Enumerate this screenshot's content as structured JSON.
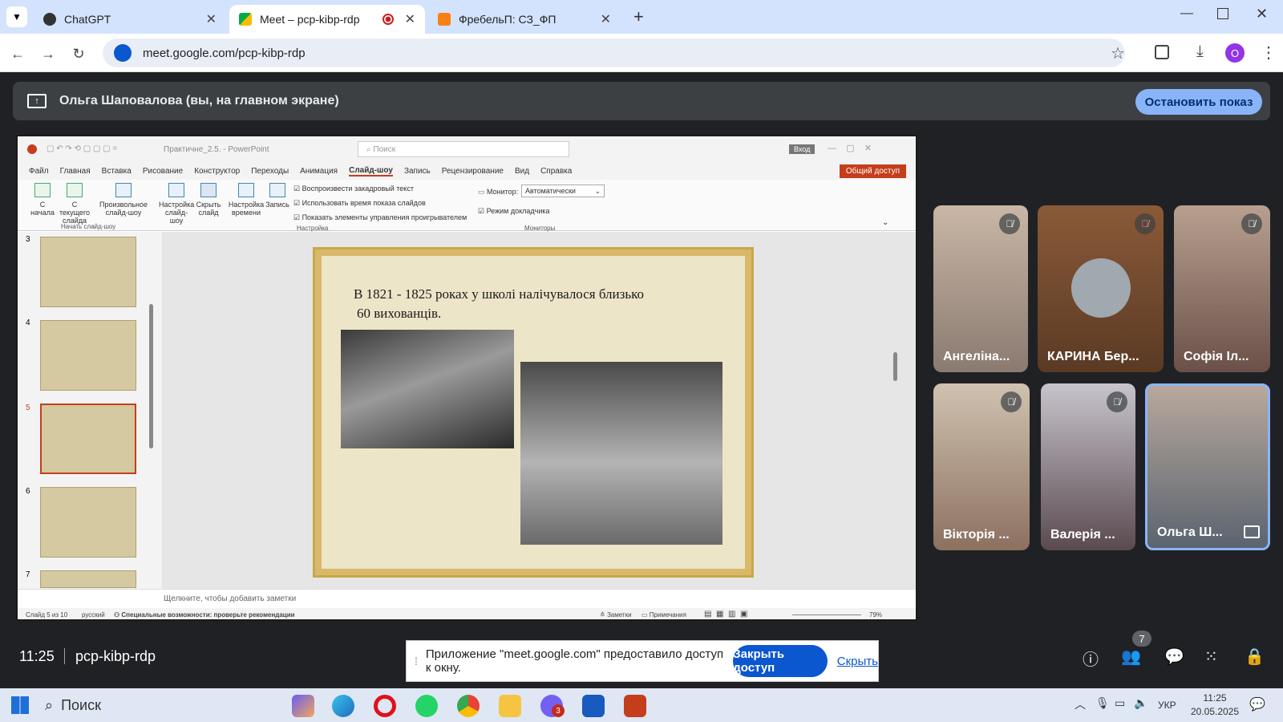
{
  "browser": {
    "tabs": [
      {
        "label": "ChatGPT"
      },
      {
        "label": "Meet – pcp-kibp-rdp"
      },
      {
        "label": "ФребельП: СЗ_ФП"
      }
    ],
    "url": "meet.google.com/pcp-kibp-rdp",
    "profile_initial": "O"
  },
  "meet": {
    "presenting_label": "Ольга Шаповалова (вы, на главном экране)",
    "stop_label": "Остановить показ",
    "time": "11:25",
    "meeting_code": "pcp-kibp-rdp",
    "participants_count": "7",
    "share_notice": "Приложение \"meet.google.com\" предоставило доступ к окну.",
    "close_access_label": "Закрыть доступ",
    "hide_label": "Скрыть",
    "participants": [
      {
        "name": "Ангеліна..."
      },
      {
        "name": "КАРИНА Бер..."
      },
      {
        "name": "Софія Іл..."
      },
      {
        "name": "Вікторія ..."
      },
      {
        "name": "Валерія ..."
      },
      {
        "name": "Ольга Ш..."
      }
    ]
  },
  "powerpoint": {
    "doc_title": "Практичне_2.5. - PowerPoint",
    "search_placeholder": "Поиск",
    "signin": "Вход",
    "share_label": "Общий доступ",
    "menu": [
      "Файл",
      "Главная",
      "Вставка",
      "Рисование",
      "Конструктор",
      "Переходы",
      "Анимация",
      "Слайд-шоу",
      "Запись",
      "Рецензирование",
      "Вид",
      "Справка"
    ],
    "ribbon": {
      "from_start": "С начала",
      "from_current": "С текущего слайда",
      "custom": "Произвольное слайд-шоу",
      "group_start": "Начать слайд-шоу",
      "setup": "Настройка слайд-шоу",
      "hide_slide": "Скрыть слайд",
      "rehearse": "Настройка времени",
      "record": "Запись",
      "chk1": "Воспроизвести закадровый текст",
      "chk2": "Использовать время показа слайдов",
      "chk3": "Показать элементы управления проигрывателем",
      "group_setup": "Настройка",
      "monitor_label": "Монитор:",
      "monitor_value": "Автоматически",
      "presenter_view": "Режим докладчика",
      "group_monitors": "Мониторы"
    },
    "thumb_numbers": [
      "3",
      "4",
      "5",
      "6",
      "7"
    ],
    "slide_text_line1": "В 1821 - 1825 роках у школі налічувалося близько",
    "slide_text_line2": "60 вихованців.",
    "notes_placeholder": "Щелкните, чтобы добавить заметки",
    "status_slide": "Слайд 5 из 10",
    "status_lang": "русский",
    "status_access": "Специальные возможности: проверьте рекомендации",
    "status_notes": "Заметки",
    "status_comments": "Примечания",
    "zoom": "79%"
  },
  "taskbar": {
    "search_placeholder": "Поиск",
    "lang": "УКР",
    "time": "11:25",
    "date": "20.05.2025",
    "viber_badge": "3"
  }
}
